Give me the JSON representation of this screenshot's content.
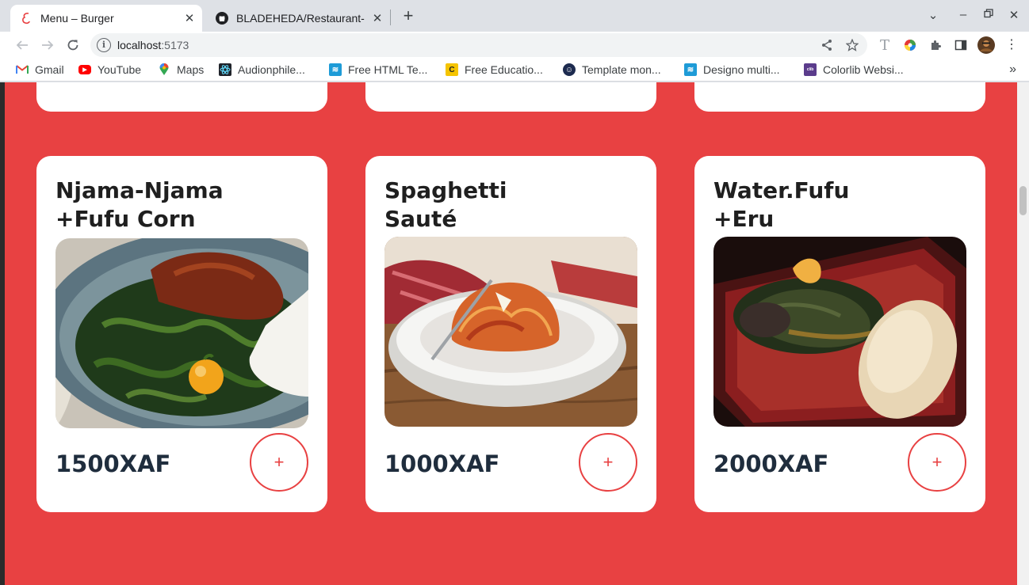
{
  "browser": {
    "tabs": [
      {
        "title": "Menu – Burger",
        "active": true
      },
      {
        "title": "BLADEHEDA/Restaurant-",
        "active": false
      }
    ],
    "address": {
      "host": "localhost",
      "port": ":5173"
    },
    "bookmarks": [
      {
        "label": "Gmail",
        "icon": "gmail-icon",
        "color": "#ea4335"
      },
      {
        "label": "YouTube",
        "icon": "youtube-icon",
        "color": "#ff0000"
      },
      {
        "label": "Maps",
        "icon": "maps-pin-icon",
        "color": "#34a853"
      },
      {
        "label": "Audionphile...",
        "icon": "react-icon",
        "color": "#20232a"
      },
      {
        "label": "Free HTML Te...",
        "icon": "site-icon",
        "color": "#1e9bd7"
      },
      {
        "label": "Free Educatio...",
        "icon": "site-icon",
        "color": "#f5c400"
      },
      {
        "label": "Template mon...",
        "icon": "site-icon",
        "color": "#1d2b4f"
      },
      {
        "label": "Designo multi...",
        "icon": "site-icon",
        "color": "#1e9bd7"
      },
      {
        "label": "Colorlib Websi...",
        "icon": "colorlib-icon",
        "color": "#5b3c8c"
      }
    ]
  },
  "theme": {
    "accent": "#e84142",
    "text_dark": "#1f2d3d"
  },
  "menu": {
    "items": [
      {
        "name": "Njama-Njama\n+Fufu Corn",
        "price": "1500XAF",
        "add_label": "+"
      },
      {
        "name": "Spaghetti\nSauté",
        "price": "1000XAF",
        "add_label": "+"
      },
      {
        "name": "Water.Fufu\n+Eru",
        "price": "2000XAF",
        "add_label": "+"
      }
    ]
  }
}
